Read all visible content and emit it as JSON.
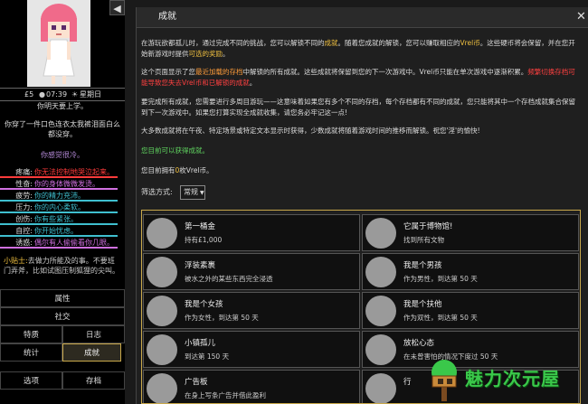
{
  "sidebar": {
    "collapse_glyph": "◀",
    "stats": {
      "money": "£5",
      "time": "07:39",
      "weekday": "星期日"
    },
    "messages": [
      {
        "text": "你明天要上学。",
        "color": "#dddddd"
      },
      {
        "text": "你穿了一件口色连衣太我裤泪面白么都没穿。",
        "color": "#dddddd"
      },
      {
        "text": "你感觉很冷。",
        "color": "#b58ad8"
      }
    ],
    "stat_rows": [
      {
        "label": "疼痛:",
        "value": "你无法控制地哭泣起来。",
        "color": "#ff3b3b"
      },
      {
        "label": "性奋:",
        "value": "你的身体微微发烫。",
        "color": "#d070e0"
      },
      {
        "label": "疲劳:",
        "value": "你的精力充沛。",
        "color": "#3fbfcf"
      },
      {
        "label": "压力:",
        "value": "你的内心柔软。",
        "color": "#3fbfcf"
      },
      {
        "label": "创伤:",
        "value": "你有些紧张。",
        "color": "#3fbfcf"
      },
      {
        "label": "自控:",
        "value": "你开始忧虑。",
        "color": "#3fbfcf"
      },
      {
        "label": "诱惑:",
        "value": "偶尔有人偷偷看你几眼。",
        "color": "#d070e0"
      }
    ],
    "tip": {
      "lead": "小贴士:",
      "text": "去做力所能及的事。不要班门弄斧，比如试图压制狐狸的尖叫。"
    },
    "nav": {
      "attributes": "属性",
      "social": "社交",
      "traits": "特质",
      "journal": "日志",
      "stats_btn": "统计",
      "achievements": "成就",
      "options": "选项",
      "save": "存档"
    }
  },
  "dialog": {
    "title": "成就",
    "close": "✕",
    "p1": {
      "a": "在游玩欲都孤儿时，通过完成不同的挑战，您可以解锁不同的",
      "b": "成就",
      "c": "。随着您成就的解锁，您可以赚取相应的",
      "d": "Vrel币",
      "e": "。这些硬币将会保留，并在您开始新游戏时提供",
      "f": "可选的奖励",
      "g": "。"
    },
    "p2": {
      "a": "这个页面显示了您",
      "b": "最近加载的存档",
      "c": "中解锁的所有成就。这些成就将保留到您的下一次游戏中。Vrel币只能在单次游戏中逐渐积累。",
      "d": "频繁切换存档可能导致您失去Vrel币和已解锁的成就",
      "e": "。"
    },
    "p3": "要完成所有成就，您需要进行多周目游玩——这意味着如果您有多个不同的存档，每个存档都有不同的成就，您只能将其中一个存档成就集合保留到下一次游戏中。如果您打算实现全成就收集，请您务必牢记这一点!",
    "p4": "大多数成就将在午夜、特定场景或特定文本显示时获得，少数成就将随着游戏时间的推移而解锁。祝您'淫'的愉快!",
    "earn_note": "您目前可以获得成就。",
    "coins": {
      "a": "您目前拥有",
      "b": "0",
      "c": "枚Vrel币。"
    },
    "filter_label": "筛选方式:",
    "filter_value": "常规",
    "achievements": [
      {
        "title": "第一桶金",
        "desc": "持有£1,000"
      },
      {
        "title": "它属于博物馆!",
        "desc": "找到所有文物"
      },
      {
        "title": "浮装素裹",
        "desc": "被水之外的某些东西完全浸透"
      },
      {
        "title": "我是个男孩",
        "desc": "作为男性，到达第 50 天"
      },
      {
        "title": "我是个女孩",
        "desc": "作为女性，到达第 50 天"
      },
      {
        "title": "我是个扶他",
        "desc": "作为双性，到达第 50 天"
      },
      {
        "title": "小镇孤儿",
        "desc": "到达第 150 天"
      },
      {
        "title": "放松心态",
        "desc": "在未曾害怕的情况下度过 50 天"
      },
      {
        "title": "广告板",
        "desc": "在身上写条广告并借此盈利"
      },
      {
        "title": "行",
        "desc": ""
      }
    ]
  },
  "watermark": {
    "text": "魅力次元屋"
  }
}
